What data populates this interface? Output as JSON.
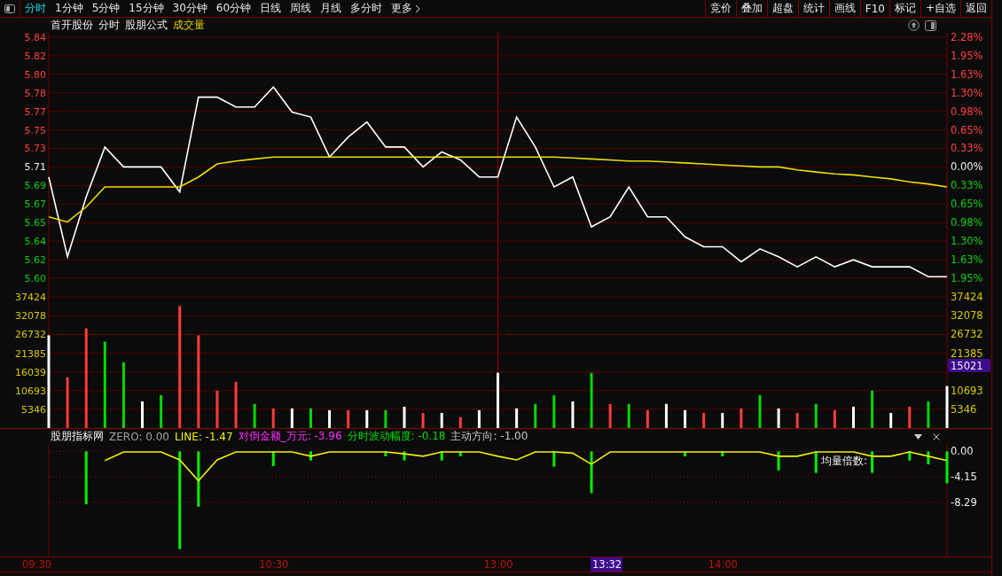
{
  "toolbar": {
    "periods": [
      {
        "label": "分时",
        "selected": true
      },
      {
        "label": "1分钟",
        "selected": false
      },
      {
        "label": "5分钟",
        "selected": false
      },
      {
        "label": "15分钟",
        "selected": false
      },
      {
        "label": "30分钟",
        "selected": false
      },
      {
        "label": "60分钟",
        "selected": false
      },
      {
        "label": "日线",
        "selected": false
      },
      {
        "label": "周线",
        "selected": false
      },
      {
        "label": "月线",
        "selected": false
      },
      {
        "label": "多分时",
        "selected": false
      }
    ],
    "more": "更多",
    "actions": [
      "竞价",
      "叠加",
      "超盘",
      "统计",
      "画线",
      "F10",
      "标记",
      "+自选",
      "返回"
    ]
  },
  "chart_header": {
    "items": [
      "首开股份",
      "分时",
      "股朋公式"
    ],
    "volume_label": "成交量"
  },
  "price": {
    "chart_data": {
      "type": "line",
      "grid": true,
      "ylim": [
        5.5986,
        5.84
      ],
      "categories": [
        null,
        null,
        null,
        null,
        null,
        null,
        null,
        null,
        null,
        null,
        null,
        null,
        null,
        null,
        null,
        null,
        null,
        null,
        null,
        null,
        null,
        null,
        null,
        null,
        null,
        null,
        null,
        null,
        null,
        null,
        null,
        null,
        null,
        null,
        null,
        null,
        null,
        null,
        null,
        null,
        null,
        null,
        null,
        null,
        null,
        null,
        null,
        null,
        null
      ],
      "yticks": [
        {
          "value": 5.84,
          "label": "5.84"
        },
        {
          "value": 5.8214,
          "label": "5.82"
        },
        {
          "value": 5.8029,
          "label": "5.80"
        },
        {
          "value": 5.7843,
          "label": "5.78"
        },
        {
          "value": 5.7657,
          "label": "5.77"
        },
        {
          "value": 5.7471,
          "label": "5.75"
        },
        {
          "value": 5.7286,
          "label": "5.73"
        },
        {
          "value": 5.71,
          "label": "5.71"
        },
        {
          "value": 5.6914,
          "label": "5.69"
        },
        {
          "value": 5.6729,
          "label": "5.67"
        },
        {
          "value": 5.6543,
          "label": "5.65"
        },
        {
          "value": 5.6357,
          "label": "5.64"
        },
        {
          "value": 5.6171,
          "label": "5.62"
        },
        {
          "value": 5.5986,
          "label": "5.60"
        }
      ],
      "series": [
        {
          "color": "#ffffff",
          "values": [
            5.7,
            5.62,
            5.68,
            5.73,
            5.71,
            5.71,
            5.71,
            5.685,
            5.78,
            5.78,
            5.77,
            5.77,
            5.79,
            5.765,
            5.76,
            5.72,
            5.74,
            5.755,
            5.73,
            5.73,
            5.71,
            5.725,
            5.717,
            5.7,
            5.7,
            5.76,
            5.73,
            5.69,
            5.7,
            5.65,
            5.66,
            5.69,
            5.66,
            5.66,
            5.64,
            5.63,
            5.63,
            5.615,
            5.628,
            5.62,
            5.61,
            5.62,
            5.61,
            5.617,
            5.61,
            5.61,
            5.61,
            5.6,
            5.6
          ]
        },
        {
          "color": "#e8e000",
          "values": [
            5.66,
            5.655,
            5.67,
            5.69,
            5.69,
            5.69,
            5.69,
            5.69,
            5.7,
            5.713,
            5.716,
            5.718,
            5.72,
            5.72,
            5.72,
            5.72,
            5.72,
            5.72,
            5.72,
            5.72,
            5.72,
            5.72,
            5.72,
            5.72,
            5.72,
            5.72,
            5.72,
            5.72,
            5.719,
            5.718,
            5.717,
            5.716,
            5.716,
            5.715,
            5.714,
            5.713,
            5.712,
            5.711,
            5.71,
            5.71,
            5.707,
            5.705,
            5.703,
            5.702,
            5.7,
            5.698,
            5.695,
            5.693,
            5.69
          ]
        }
      ]
    },
    "percent_labels": [
      {
        "label": "2.28%",
        "color": "#ff4040"
      },
      {
        "label": "1.95%",
        "color": "#ff4040"
      },
      {
        "label": "1.63%",
        "color": "#ff4040"
      },
      {
        "label": "1.30%",
        "color": "#ff4040"
      },
      {
        "label": "0.98%",
        "color": "#ff4040"
      },
      {
        "label": "0.65%",
        "color": "#ff4040"
      },
      {
        "label": "0.33%",
        "color": "#ff4040"
      },
      {
        "label": "0.00%",
        "color": "#f0f0f0"
      },
      {
        "label": "0.33%",
        "color": "#10d010"
      },
      {
        "label": "0.65%",
        "color": "#10d010"
      },
      {
        "label": "0.98%",
        "color": "#10d010"
      },
      {
        "label": "1.30%",
        "color": "#10d010"
      },
      {
        "label": "1.63%",
        "color": "#10d010"
      },
      {
        "label": "1.95%",
        "color": "#10d010"
      }
    ]
  },
  "volume": {
    "chart_data": {
      "type": "bar",
      "stacked": true,
      "grid": true,
      "ylim": [
        0,
        37424
      ],
      "categories": [
        null,
        null,
        null,
        null,
        null,
        null,
        null,
        null,
        null,
        null,
        null,
        null,
        null,
        null,
        null,
        null,
        null,
        null,
        null,
        null,
        null,
        null,
        null,
        null,
        null,
        null,
        null,
        null,
        null,
        null,
        null,
        null,
        null,
        null,
        null,
        null,
        null,
        null,
        null,
        null,
        null,
        null,
        null,
        null,
        null,
        null,
        null,
        null,
        null
      ],
      "yticks": [
        {
          "value": 37424,
          "label": "37424"
        },
        {
          "value": 32078,
          "label": "32078"
        },
        {
          "value": 26732,
          "label": "26732"
        },
        {
          "value": 21385,
          "label": "21385"
        },
        {
          "value": 16039,
          "label": "16039"
        },
        {
          "value": 10693,
          "label": "10693"
        },
        {
          "value": 5346,
          "label": "5346"
        }
      ],
      "series": [
        {
          "color": "#ff3c3c",
          "values": [
            0,
            14500,
            28500,
            0,
            0,
            0,
            0,
            34900,
            26500,
            10700,
            13200,
            0,
            5600,
            0,
            0,
            0,
            5100,
            0,
            0,
            0,
            4300,
            0,
            3100,
            0,
            0,
            0,
            0,
            0,
            0,
            0,
            6900,
            0,
            5100,
            0,
            0,
            4300,
            0,
            5600,
            0,
            0,
            4300,
            0,
            5100,
            0,
            0,
            0,
            6100,
            0,
            0
          ]
        },
        {
          "color": "#00d800",
          "values": [
            0,
            0,
            0,
            24700,
            18800,
            0,
            9400,
            0,
            0,
            0,
            0,
            6900,
            0,
            0,
            5600,
            0,
            0,
            0,
            5100,
            0,
            0,
            0,
            0,
            0,
            0,
            0,
            6900,
            9400,
            0,
            15800,
            0,
            6900,
            0,
            0,
            0,
            0,
            0,
            0,
            9400,
            0,
            0,
            6900,
            0,
            0,
            10700,
            0,
            0,
            7600,
            0
          ]
        },
        {
          "color": "#ffffff",
          "values": [
            26500,
            0,
            0,
            0,
            0,
            7600,
            0,
            0,
            0,
            0,
            0,
            0,
            0,
            5600,
            0,
            5100,
            0,
            5100,
            0,
            6100,
            0,
            4300,
            0,
            5100,
            15800,
            5600,
            0,
            0,
            7600,
            0,
            0,
            0,
            0,
            6900,
            5100,
            0,
            4300,
            0,
            0,
            5600,
            0,
            0,
            0,
            6100,
            0,
            4300,
            0,
            0,
            12000
          ]
        }
      ]
    },
    "right_labels": [
      {
        "label": "37424",
        "kind": "tick"
      },
      {
        "label": "32078",
        "kind": "tick"
      },
      {
        "label": "26732",
        "kind": "tick"
      },
      {
        "label": "21385",
        "kind": "tick"
      },
      {
        "label": "15021",
        "kind": "cursor"
      },
      {
        "label": "10693",
        "kind": "tick"
      },
      {
        "label": "5346",
        "kind": "tick"
      }
    ]
  },
  "indicator": {
    "title": "股朋指标网",
    "readouts": [
      {
        "label": "ZERO: 0.00",
        "color": "#a0a0a0"
      },
      {
        "label": "LINE: -1.47",
        "color": "#f0f000"
      },
      {
        "label": "对倒金额_万元: -3.96",
        "color": "#ff30ff"
      },
      {
        "label": "分时波动幅度: -0.18",
        "color": "#00e000"
      },
      {
        "label": "主动方向: -1.00",
        "color": "#c8c8c8"
      }
    ],
    "note": "均量倍数:",
    "chart_data": {
      "type": "bar",
      "grid": true,
      "ylim": [
        -17.1,
        1.2
      ],
      "categories": [
        null,
        null,
        null,
        null,
        null,
        null,
        null,
        null,
        null,
        null,
        null,
        null,
        null,
        null,
        null,
        null,
        null,
        null,
        null,
        null,
        null,
        null,
        null,
        null,
        null,
        null,
        null,
        null,
        null,
        null,
        null,
        null,
        null,
        null,
        null,
        null,
        null,
        null,
        null,
        null,
        null,
        null,
        null,
        null,
        null,
        null,
        null,
        null,
        null
      ],
      "yticks": [
        {
          "value": 0,
          "label": "0.00"
        },
        {
          "value": -4.15,
          "label": "-4.15"
        },
        {
          "value": -8.29,
          "label": "-8.29"
        }
      ],
      "series": [
        {
          "color": "#00f000",
          "values": [
            0,
            0,
            -8.6,
            0,
            0,
            0,
            0,
            -15.9,
            -9.0,
            0,
            0,
            0,
            -2.4,
            0,
            -1.5,
            0,
            0,
            0,
            -0.8,
            -1.5,
            0,
            -1.5,
            -0.8,
            0,
            0,
            0,
            0,
            -2.5,
            0,
            -6.8,
            0,
            0,
            0,
            0,
            -0.8,
            0,
            -0.8,
            0,
            0,
            -3.1,
            0,
            -3.5,
            0,
            0,
            -3.5,
            0,
            -1.5,
            -2.1,
            -5.2
          ]
        },
        {
          "type": "line",
          "color": "#f0f000",
          "values": [
            null,
            null,
            null,
            -1.5,
            -0.1,
            -0.1,
            -0.1,
            -1.4,
            -4.8,
            -1.4,
            -0.1,
            -0.1,
            -0.1,
            -0.1,
            -0.8,
            -0.1,
            -0.1,
            -0.1,
            -0.1,
            -0.4,
            -0.8,
            -0.1,
            -0.1,
            -0.1,
            -0.8,
            -1.4,
            -0.1,
            -0.1,
            -0.3,
            -2.1,
            -0.1,
            -0.1,
            -0.1,
            -0.1,
            -0.1,
            -0.1,
            -0.1,
            -0.1,
            -0.1,
            -0.8,
            -0.8,
            -0.1,
            -0.1,
            -0.1,
            -0.8,
            -0.8,
            -0.1,
            -0.8,
            -1.5
          ]
        }
      ]
    }
  },
  "time_axis": [
    "09:30",
    "10:30",
    "13:00",
    "14:00"
  ],
  "cursor_time": "13:32"
}
